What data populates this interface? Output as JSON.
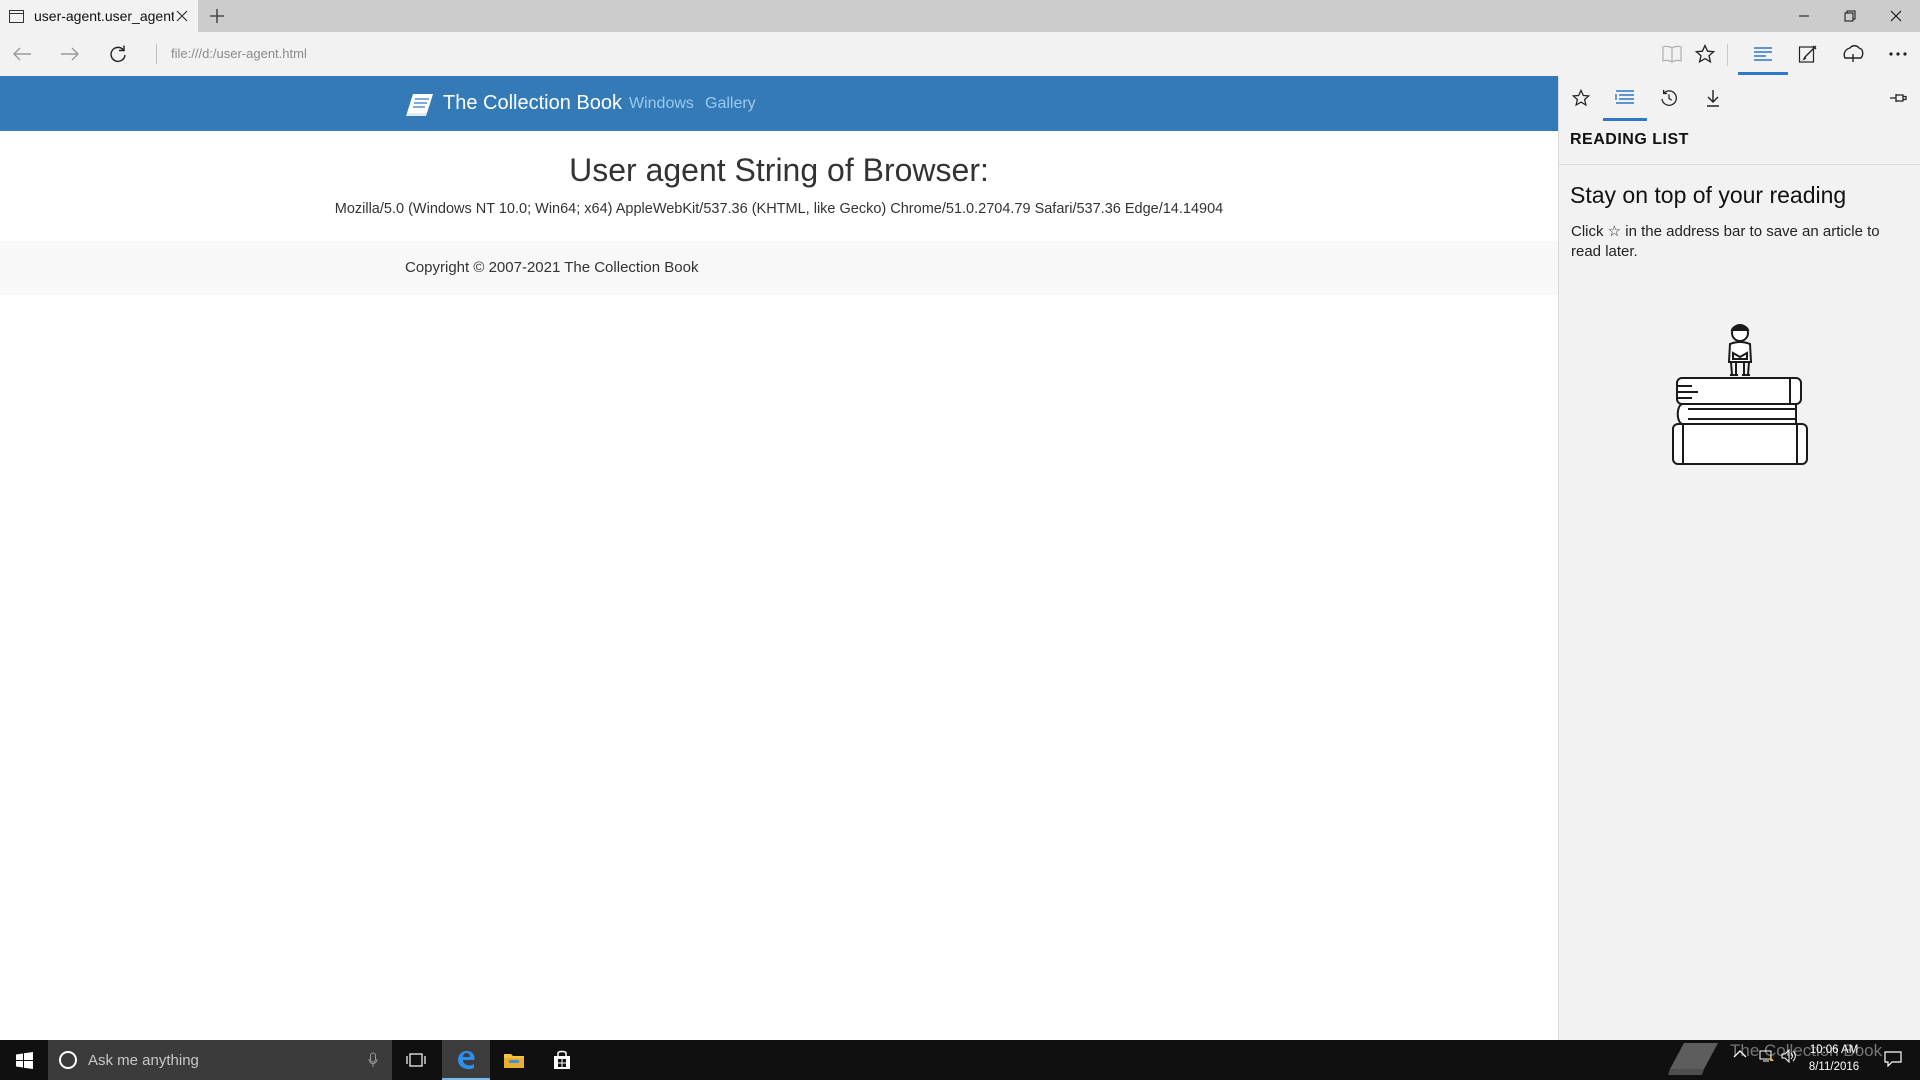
{
  "browser": {
    "tab_title": "user-agent.user_agent -",
    "address": "file:///d:/user-agent.html",
    "icons": [
      "page-icon",
      "close-icon",
      "plus-icon",
      "minimize-icon",
      "restore-icon",
      "close-window-icon",
      "back-arrow-icon",
      "forward-arrow-icon",
      "refresh-icon",
      "reading-view-icon",
      "star-icon",
      "hub-icon",
      "web-note-icon",
      "share-icon",
      "more-icon"
    ]
  },
  "site": {
    "brand": "The Collection Book",
    "nav": [
      "Windows",
      "Gallery"
    ],
    "heading": "User agent String of Browser:",
    "user_agent": "Mozilla/5.0 (Windows NT 10.0; Win64; x64) AppleWebKit/537.36 (KHTML, like Gecko) Chrome/51.0.2704.79 Safari/537.36 Edge/14.14904",
    "copyright": "Copyright © 2007-2021 The Collection Book",
    "header_color": "#337ab7"
  },
  "hub": {
    "title": "READING LIST",
    "heading": "Stay on top of your reading",
    "description": "Click ☆ in the address bar to save an article to read later.",
    "tabs": [
      "favorites",
      "reading-list",
      "history",
      "downloads"
    ],
    "active_tab": "reading-list",
    "accent": "#2e78c7"
  },
  "taskbar": {
    "search_placeholder": "Ask me anything",
    "time": "10:06 AM",
    "date": "8/11/2016",
    "watermark": "The Collection Book"
  }
}
